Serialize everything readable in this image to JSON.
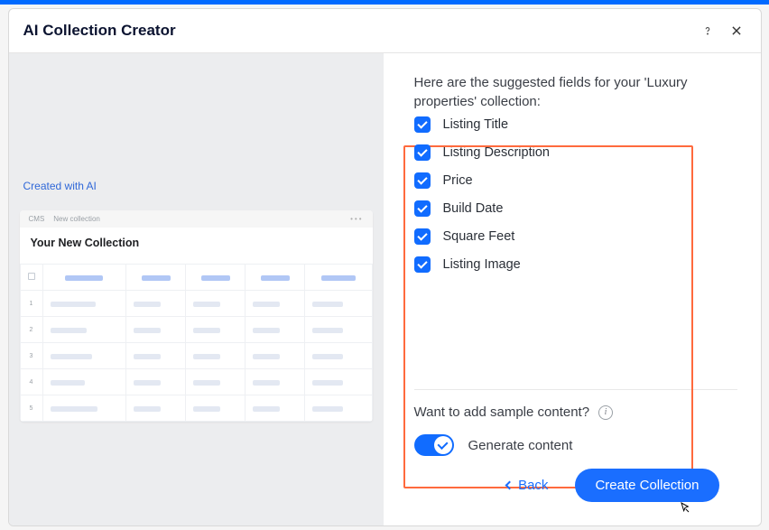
{
  "header": {
    "title": "AI Collection Creator"
  },
  "left": {
    "ai_label": "Created with AI",
    "crumb1": "CMS",
    "crumb2": "New collection",
    "preview_title": "Your New Collection"
  },
  "right": {
    "intro": "Here are the suggested fields for your 'Luxury properties' collection:",
    "fields": [
      {
        "label": "Listing Title",
        "checked": true
      },
      {
        "label": "Listing Description",
        "checked": true
      },
      {
        "label": "Price",
        "checked": true
      },
      {
        "label": "Build Date",
        "checked": true
      },
      {
        "label": "Square Feet",
        "checked": true
      },
      {
        "label": "Listing Image",
        "checked": true
      }
    ],
    "sample_prompt": "Want to add sample content?",
    "generate_label": "Generate content",
    "generate_on": true
  },
  "footer": {
    "back": "Back",
    "create": "Create Collection"
  }
}
